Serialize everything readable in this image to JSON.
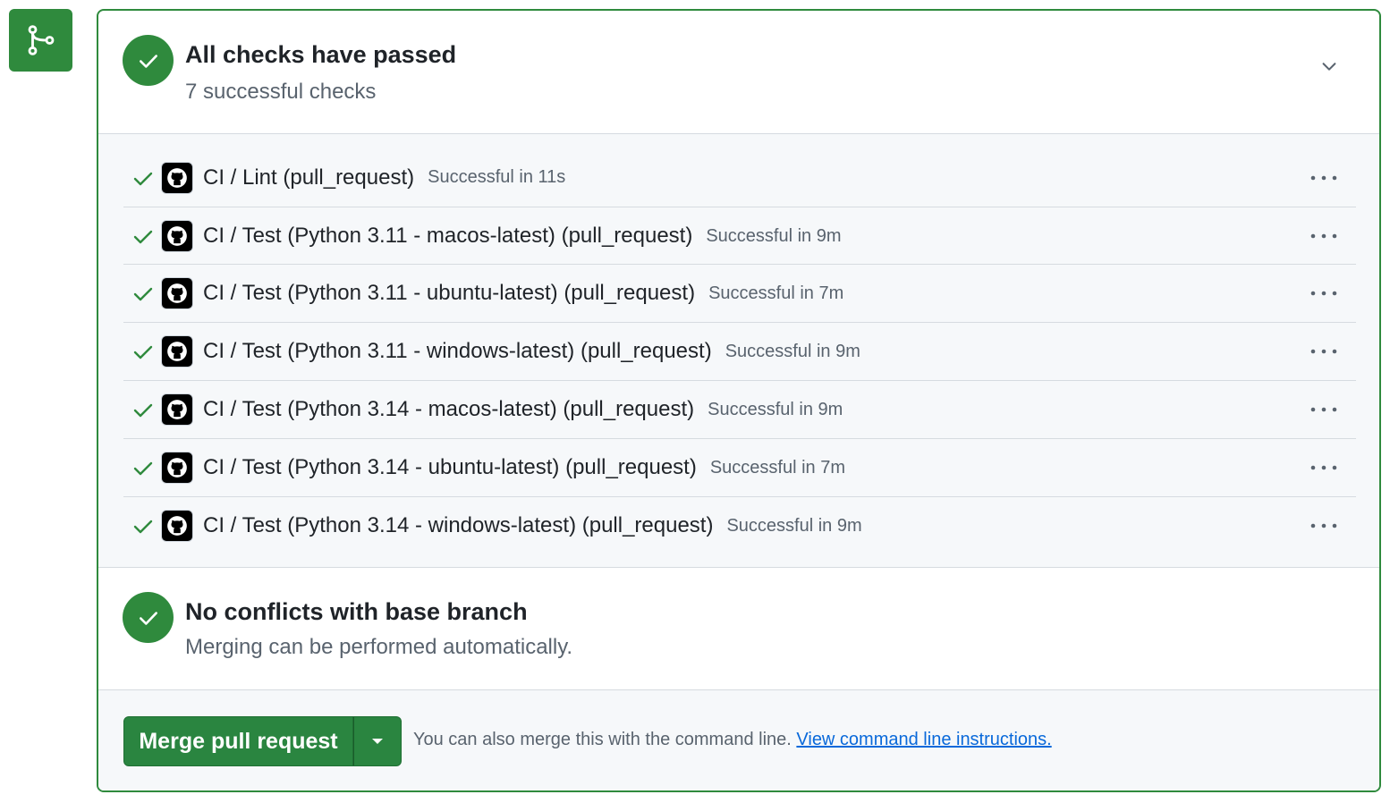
{
  "colors": {
    "success": "#2f8a3d",
    "border": "#d6dbe0",
    "muted_text": "#59636e",
    "link": "#0969da",
    "list_bg": "#f6f8fa"
  },
  "side_icon": "git-merge-icon",
  "checks_summary": {
    "title": "All checks have passed",
    "subtitle": "7 successful checks",
    "icon": "check-circle-icon",
    "toggle_icon": "chevron-down-icon"
  },
  "checks": [
    {
      "name": "CI / Lint (pull_request)",
      "status": "Successful in 11s"
    },
    {
      "name": "CI / Test (Python 3.11 - macos-latest) (pull_request)",
      "status": "Successful in 9m"
    },
    {
      "name": "CI / Test (Python 3.11 - ubuntu-latest) (pull_request)",
      "status": "Successful in 7m"
    },
    {
      "name": "CI / Test (Python 3.11 - windows-latest) (pull_request)",
      "status": "Successful in 9m"
    },
    {
      "name": "CI / Test (Python 3.14 - macos-latest) (pull_request)",
      "status": "Successful in 9m"
    },
    {
      "name": "CI / Test (Python 3.14 - ubuntu-latest) (pull_request)",
      "status": "Successful in 7m"
    },
    {
      "name": "CI / Test (Python 3.14 - windows-latest) (pull_request)",
      "status": "Successful in 9m"
    }
  ],
  "conflicts": {
    "title": "No conflicts with base branch",
    "subtitle": "Merging can be performed automatically."
  },
  "merge": {
    "button_label": "Merge pull request",
    "note": "You can also merge this with the command line.",
    "link_text": "View command line instructions."
  }
}
